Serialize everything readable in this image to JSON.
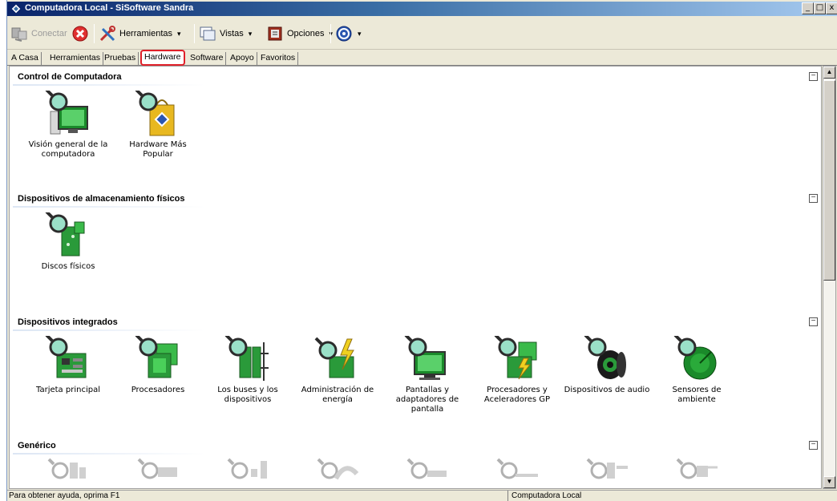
{
  "window": {
    "title": "Computadora Local - SiSoftware Sandra",
    "minimize": "_",
    "maximize": "□",
    "close": "x"
  },
  "toolbar": {
    "connect_label": "Conectar",
    "tools_label": "Herramientas",
    "views_label": "Vistas",
    "options_label": "Opciones",
    "dropdown_glyph": "▾"
  },
  "tabs": [
    {
      "label": "A Casa"
    },
    {
      "label": "Herramientas"
    },
    {
      "label": "Pruebas"
    },
    {
      "label": "Hardware"
    },
    {
      "label": "Software"
    },
    {
      "label": "Apoyo"
    },
    {
      "label": "Favoritos"
    }
  ],
  "sections": [
    {
      "title": "Control de Computadora",
      "items": [
        {
          "label": "Visión general de la computadora"
        },
        {
          "label": "Hardware Más Popular"
        }
      ]
    },
    {
      "title": "Dispositivos de almacenamiento físicos",
      "items": [
        {
          "label": "Discos físicos"
        }
      ]
    },
    {
      "title": "Dispositivos integrados",
      "items": [
        {
          "label": "Tarjeta principal"
        },
        {
          "label": "Procesadores"
        },
        {
          "label": "Los buses y los dispositivos"
        },
        {
          "label": "Administración de energía"
        },
        {
          "label": "Pantallas y adaptadores de pantalla"
        },
        {
          "label": "Procesadores y Aceleradores GP"
        },
        {
          "label": "Dispositivos de audio"
        },
        {
          "label": "Sensores de ambiente"
        }
      ]
    },
    {
      "title": "Genérico",
      "items": []
    }
  ],
  "collapse_glyph": "−",
  "scrollbar": {
    "up": "▲",
    "down": "▼"
  },
  "status": {
    "left": "Para obtener ayuda, oprima F1",
    "right": "Computadora Local"
  }
}
